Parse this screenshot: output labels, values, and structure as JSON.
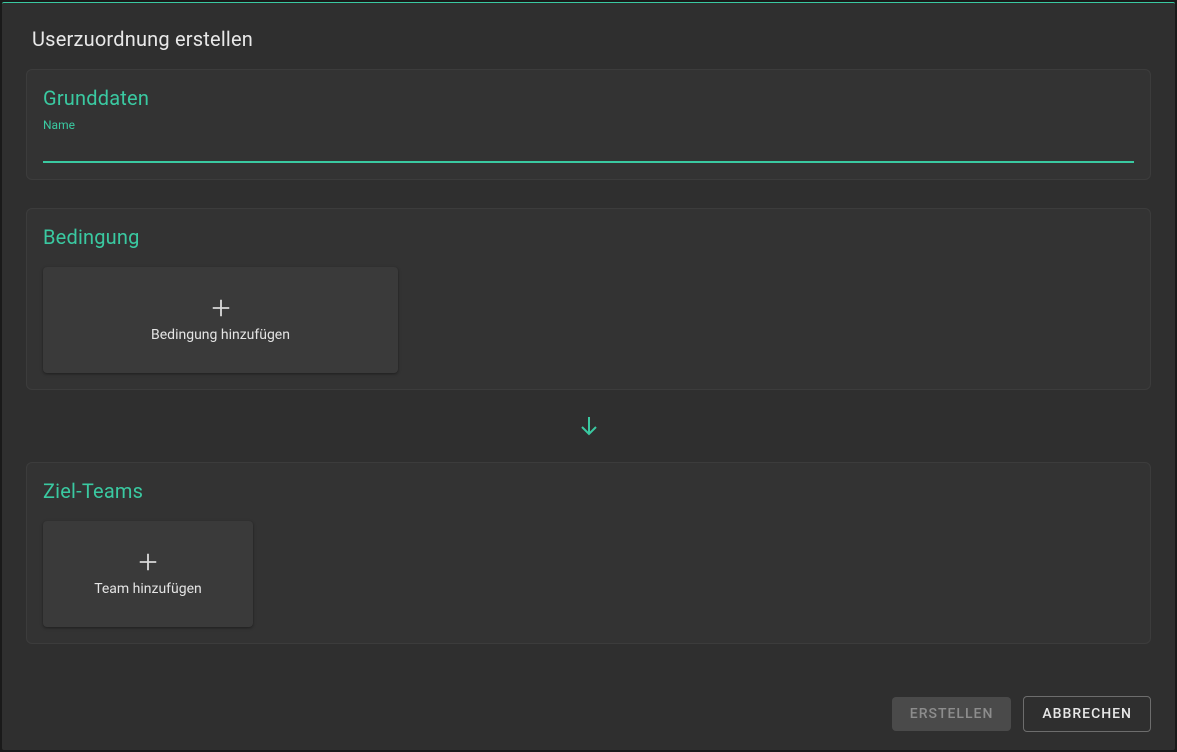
{
  "dialog": {
    "title": "Userzuordnung erstellen"
  },
  "sections": {
    "basic": {
      "title": "Grunddaten",
      "name_label": "Name",
      "name_value": ""
    },
    "condition": {
      "title": "Bedingung",
      "add_label": "Bedingung hinzufügen"
    },
    "targets": {
      "title": "Ziel-Teams",
      "add_label": "Team hinzufügen"
    }
  },
  "footer": {
    "create_label": "ERSTELLEN",
    "cancel_label": "ABBRECHEN"
  },
  "colors": {
    "accent": "#3ac9a1",
    "background": "#2f2f2f",
    "card": "#333333",
    "tile": "#3a3a3a"
  }
}
